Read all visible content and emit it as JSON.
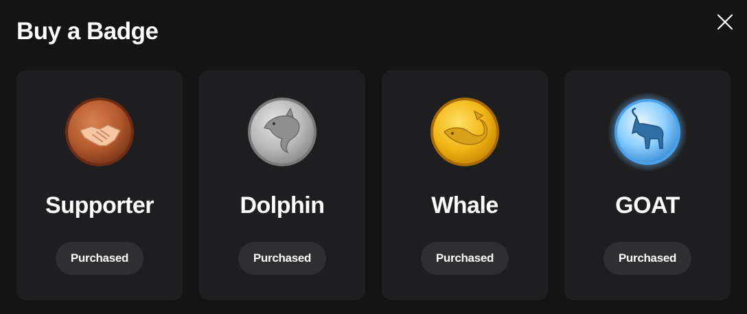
{
  "modal": {
    "title": "Buy a Badge",
    "close_icon": "close-icon"
  },
  "badges": [
    {
      "name": "Supporter",
      "status": "Purchased",
      "icon": "handshake-icon",
      "color": "#b35a2e"
    },
    {
      "name": "Dolphin",
      "status": "Purchased",
      "icon": "dolphin-icon",
      "color": "#b9b9b9"
    },
    {
      "name": "Whale",
      "status": "Purchased",
      "icon": "whale-icon",
      "color": "#f2b616"
    },
    {
      "name": "GOAT",
      "status": "Purchased",
      "icon": "goat-icon",
      "color": "#6fc0ff"
    }
  ]
}
